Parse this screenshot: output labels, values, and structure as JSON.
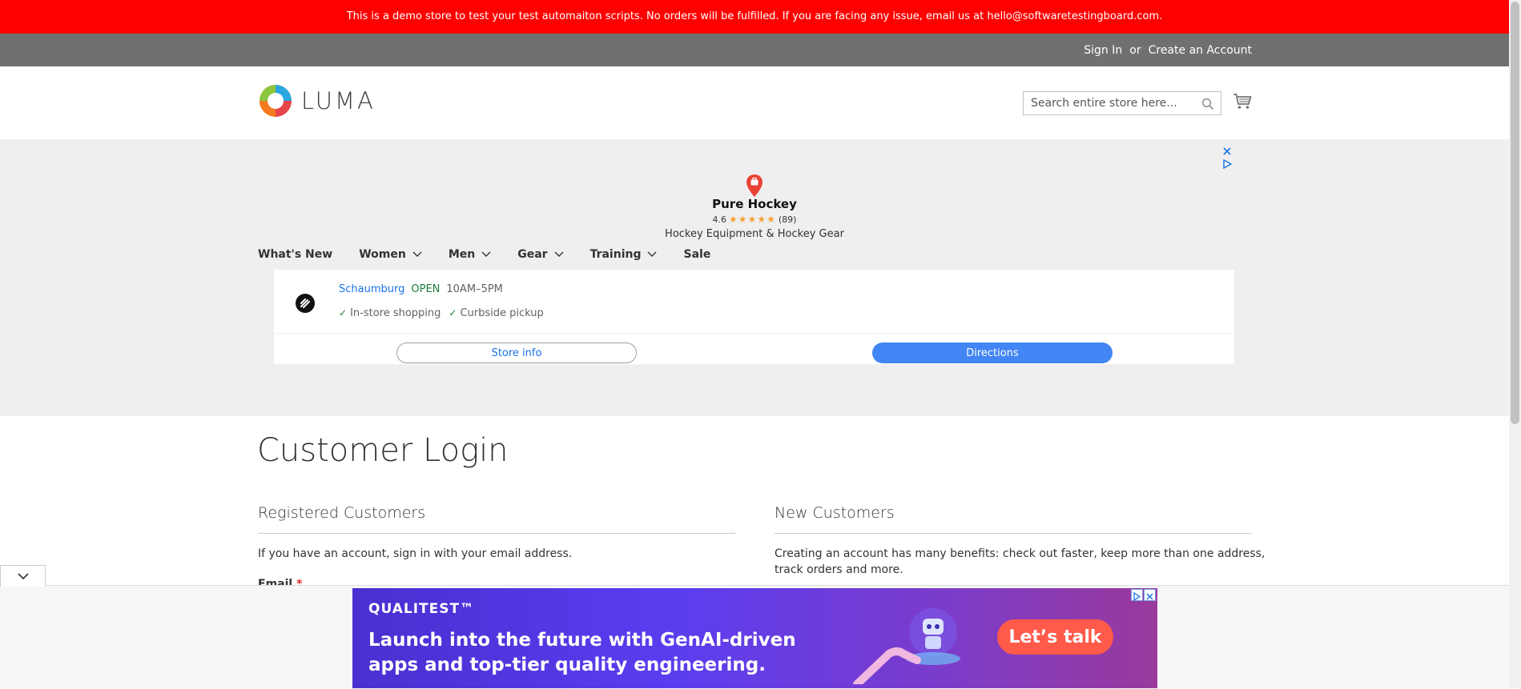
{
  "demo_banner": {
    "text": "This is a demo store to test your test automaiton scripts. No orders will be fulfilled. If you are facing any issue, email us at hello@softwaretestingboard.com."
  },
  "header": {
    "sign_in": "Sign In",
    "or": "or",
    "create_account": "Create an Account"
  },
  "logo": {
    "text": "LUMA"
  },
  "search": {
    "placeholder": "Search entire store here..."
  },
  "ad_top": {
    "business_name": "Pure Hockey",
    "rating": "4.6",
    "stars": "★★★★★",
    "review_count": "(89)",
    "description": "Hockey Equipment & Hockey Gear",
    "location": "Schaumburg",
    "status": "OPEN",
    "hours": "10AM–5PM",
    "feature1": "In-store shopping",
    "feature2": "Curbside pickup",
    "store_info_button": "Store info",
    "directions_button": "Directions"
  },
  "nav": {
    "items": [
      "What's New",
      "Women",
      "Men",
      "Gear",
      "Training",
      "Sale"
    ]
  },
  "page": {
    "title": "Customer Login"
  },
  "registered": {
    "title": "Registered Customers",
    "text": "If you have an account, sign in with your email address.",
    "email_label": "Email",
    "required_marker": "*"
  },
  "new_customers": {
    "title": "New Customers",
    "text_line1": "Creating an account has many benefits: check out faster, keep more than one address,",
    "text_line2": "track orders and more."
  },
  "bottom_ad": {
    "brand": "QUALITEST™",
    "line1": "Launch into the future with GenAI-driven",
    "line2": "apps and top-tier quality engineering.",
    "cta": "Let’s talk"
  },
  "colors": {
    "banner": "#ff0000",
    "header_bar": "#6e716e",
    "directions": "#4285f4",
    "open": "#188038"
  }
}
